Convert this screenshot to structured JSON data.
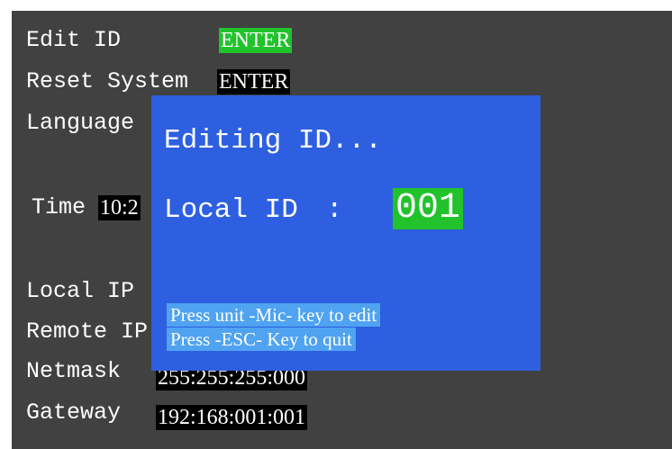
{
  "menu": {
    "edit_id_label": "Edit ID",
    "edit_id_value": "ENTER",
    "reset_system_label": "Reset System",
    "reset_system_value": "ENTER",
    "language_label": "Language",
    "time_label": "Time",
    "time_value_visible": "10:2",
    "local_ip_label": "Local IP",
    "remote_ip_label": "Remote IP",
    "netmask_label": "Netmask",
    "netmask_value": "255:255:255:000",
    "gateway_label": "Gateway",
    "gateway_value": "192:168:001:001"
  },
  "dialog": {
    "title": "Editing ID...",
    "local_id_label": "Local ID",
    "separator": ":",
    "local_id_value": "001",
    "hint_edit": "Press unit -Mic- key to edit",
    "hint_quit": "Press -ESC- Key to quit"
  },
  "colors": {
    "screen_bg": "#414141",
    "dialog_bg": "#2d5fe0",
    "highlight_green": "#22c22d",
    "hint_bg": "#4fa3f0"
  }
}
